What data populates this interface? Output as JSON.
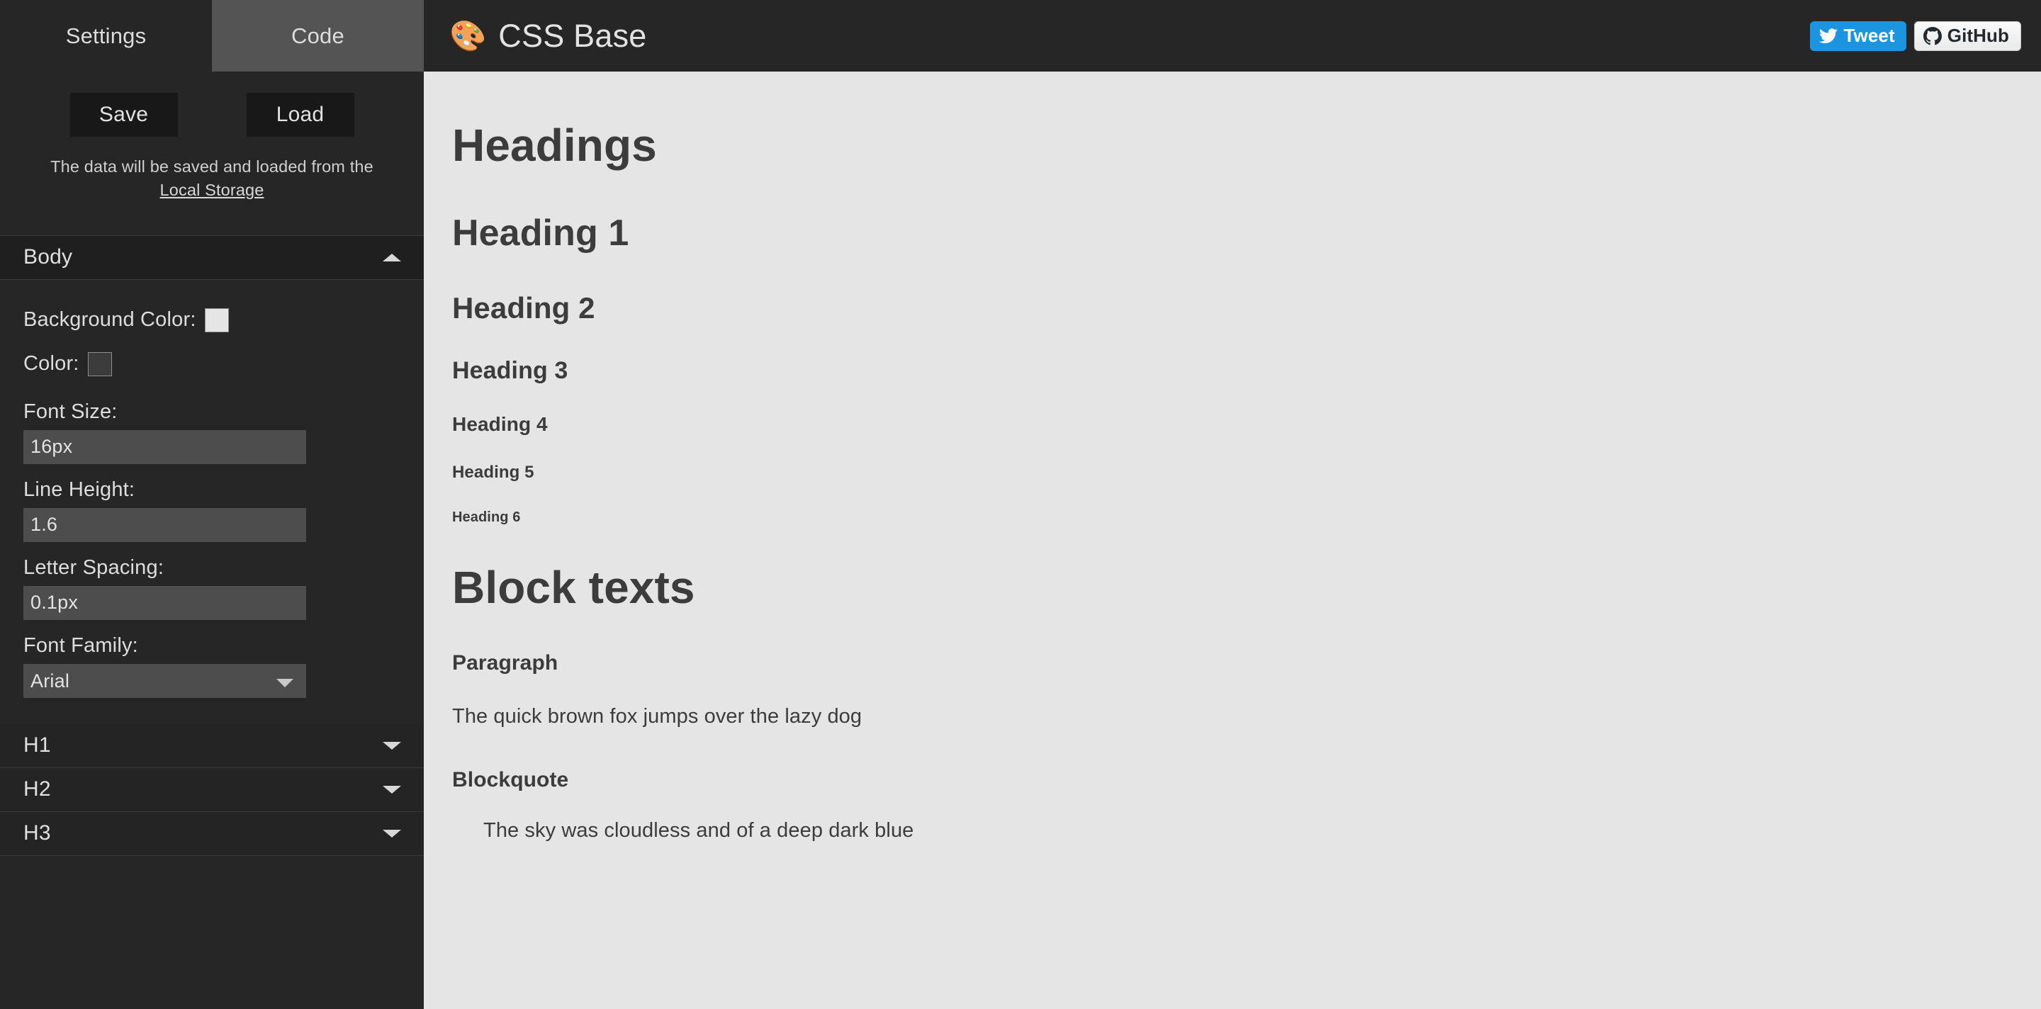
{
  "sidebar": {
    "tabs": [
      {
        "label": "Settings",
        "active": false
      },
      {
        "label": "Code",
        "active": true
      }
    ],
    "save_button": "Save",
    "load_button": "Load",
    "hint_text": "The data will be saved and loaded from the",
    "hint_link": "Local Storage",
    "sections": [
      {
        "title": "Body",
        "expanded": true
      },
      {
        "title": "H1",
        "expanded": false
      },
      {
        "title": "H2",
        "expanded": false
      },
      {
        "title": "H3",
        "expanded": false
      }
    ],
    "body_fields": {
      "background_color_label": "Background Color:",
      "background_color_value": "#e5e5e5",
      "color_label": "Color:",
      "color_value": "#3c3c3c",
      "font_size_label": "Font Size:",
      "font_size_value": "16px",
      "line_height_label": "Line Height:",
      "line_height_value": "1.6",
      "letter_spacing_label": "Letter Spacing:",
      "letter_spacing_value": "0.1px",
      "font_family_label": "Font Family:",
      "font_family_value": "Arial",
      "font_family_options": [
        "Arial"
      ]
    }
  },
  "topbar": {
    "logo_icon": "palette-icon",
    "logo_emoji": "🎨",
    "title": "CSS Base",
    "tweet_label": "Tweet",
    "tweet_color": "#1b95e0",
    "github_label": "GitHub"
  },
  "preview": {
    "section_headings": "Headings",
    "heading1": "Heading 1",
    "heading2": "Heading 2",
    "heading3": "Heading 3",
    "heading4": "Heading 4",
    "heading5": "Heading 5",
    "heading6": "Heading 6",
    "section_block_texts": "Block texts",
    "paragraph_label": "Paragraph",
    "paragraph_text": "The quick brown fox jumps over the lazy dog",
    "blockquote_label": "Blockquote",
    "blockquote_text": "The sky was cloudless and of a deep dark blue"
  }
}
